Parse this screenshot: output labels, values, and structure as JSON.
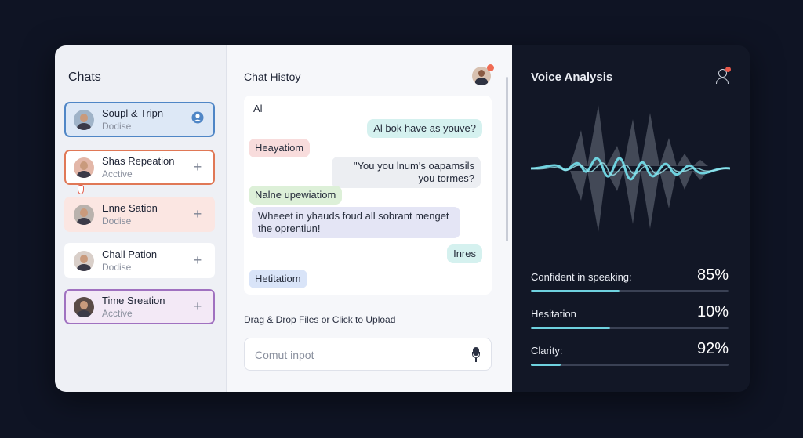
{
  "sidebar": {
    "title": "Chats",
    "contacts": [
      {
        "name": "Soupl & Tripn",
        "status": "Dodise",
        "icon": "user-circle-icon"
      },
      {
        "name": "Shas Repeation",
        "status": "Acctive",
        "icon": "plus-icon"
      },
      {
        "name": "Enne Sation",
        "status": "Dodise",
        "icon": "plus-icon"
      },
      {
        "name": "Chall Pation",
        "status": "Dodise",
        "icon": "plus-icon"
      },
      {
        "name": "Time Sreation",
        "status": "Acctive",
        "icon": "plus-icon"
      }
    ]
  },
  "chat": {
    "title": "Chat Histoy",
    "messages": [
      {
        "text": "Al",
        "side": "left",
        "color": "#ffffff"
      },
      {
        "text": "Al bok have as youve?",
        "side": "right",
        "color": "#d5f1ef"
      },
      {
        "text": "Heayatiom",
        "side": "left",
        "color": "#f8dcdc"
      },
      {
        "text": "\"You you lnum's oapamsils you tormes?",
        "side": "right",
        "color": "#eceef2"
      },
      {
        "text": "Nalne upewiatiom",
        "side": "left",
        "color": "#ddf0d8"
      },
      {
        "text": "Wheeet in yhauds foud all sobrant menget the oprentiun!",
        "side": "left",
        "color": "#e4e5f5"
      },
      {
        "text": "Inres",
        "side": "right",
        "color": "#d5f1ef"
      },
      {
        "text": "Hetitatiom",
        "side": "left",
        "color": "#d9e4f8"
      }
    ],
    "upload_label": "Drag & Drop Files or Click to Upload",
    "input_placeholder": "Comut inpot"
  },
  "voice": {
    "title": "Voice Analysis",
    "metrics": [
      {
        "label": "Confident in speaking:",
        "value": "85%",
        "fraction": 0.45
      },
      {
        "label": "Hesitation",
        "value": "10%",
        "fraction": 0.4
      },
      {
        "label": "Clarity:",
        "value": "92%",
        "fraction": 0.15
      }
    ]
  },
  "colors": {
    "accent_teal": "#6fd2df",
    "notification_red": "#f06b53",
    "sidebar_selected_blue": "#4f86c6",
    "sidebar_orange": "#e07856",
    "sidebar_purple": "#a071c0"
  }
}
